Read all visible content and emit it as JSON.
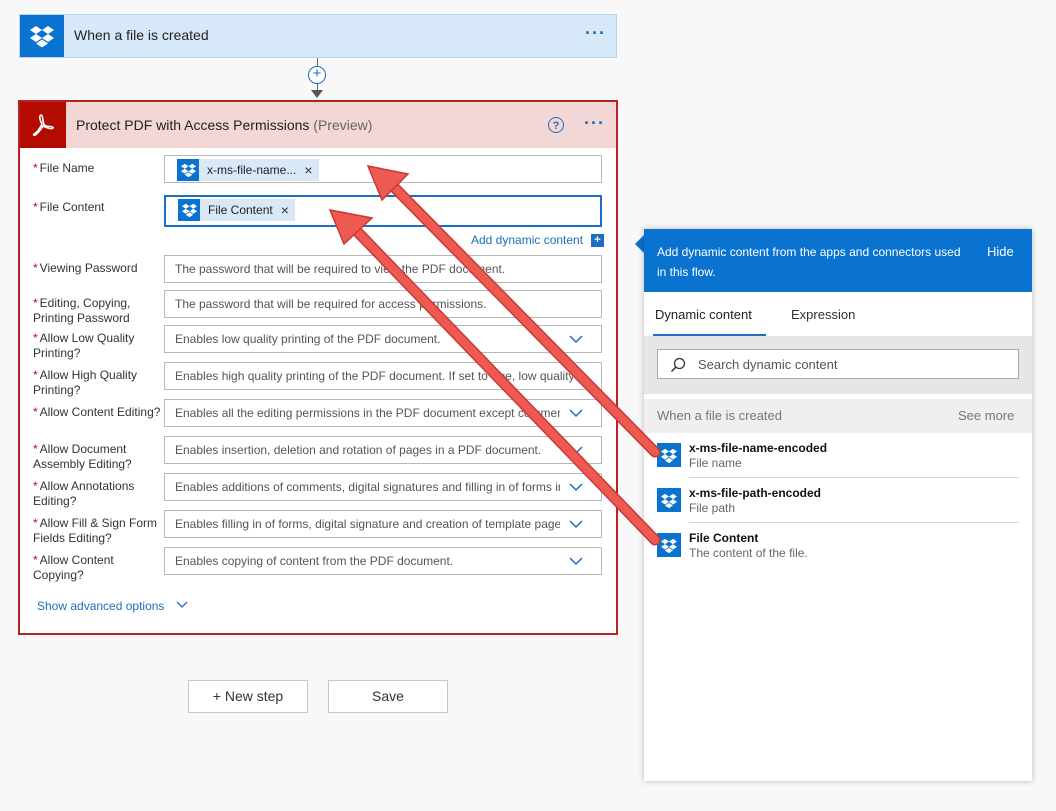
{
  "trigger": {
    "title": "When a file is created",
    "more_label": "···"
  },
  "connector": {
    "add_label": "+"
  },
  "action": {
    "title": "Protect PDF with Access Permissions",
    "preview_label": "(Preview)",
    "help_label": "?",
    "more_label": "···",
    "add_dynamic_content": "Add dynamic content",
    "add_dynamic_icon": "+",
    "show_advanced": "Show advanced options",
    "required_marker": "*",
    "fields": {
      "file_name": {
        "label": "File Name",
        "token": "x-ms-file-name...",
        "token_remove": "×"
      },
      "file_content": {
        "label": "File Content",
        "token": "File Content",
        "token_remove": "×"
      },
      "viewing_password": {
        "label": "Viewing Password",
        "placeholder": "The password that will be required to view the PDF document."
      },
      "editing_password": {
        "label": "Editing, Copying, Printing Password",
        "placeholder": "The password that will be required for access permissions."
      },
      "low_quality": {
        "label": "Allow Low Quality Printing?",
        "placeholder": "Enables low quality printing of the PDF document."
      },
      "high_quality": {
        "label": "Allow High Quality Printing?",
        "placeholder": "Enables high quality printing of the PDF document. If set to true, low quality"
      },
      "content_editing": {
        "label": "Allow Content Editing?",
        "placeholder": "Enables all the editing permissions in the PDF document except comments"
      },
      "document_assembly": {
        "label": "Allow Document Assembly Editing?",
        "placeholder": "Enables insertion, deletion and rotation of pages in a PDF document."
      },
      "annotations": {
        "label": "Allow Annotations Editing?",
        "placeholder": "Enables additions of comments, digital signatures and filling in of forms in"
      },
      "fill_sign": {
        "label": "Allow Fill & Sign Form Fields Editing?",
        "placeholder": "Enables filling in of forms, digital signature and creation of template pages"
      },
      "content_copying": {
        "label": "Allow Content Copying?",
        "placeholder": "Enables copying of content from the PDF document."
      }
    }
  },
  "buttons": {
    "new_step": "+ New step",
    "save": "Save"
  },
  "panel": {
    "info": "Add dynamic content from the apps and connectors used in this flow.",
    "hide": "Hide",
    "tabs": [
      "Dynamic content",
      "Expression"
    ],
    "search_placeholder": "Search dynamic content",
    "section_title": "When a file is created",
    "see_more": "See more",
    "items": [
      {
        "name": "x-ms-file-name-encoded",
        "desc": "File name"
      },
      {
        "name": "x-ms-file-path-encoded",
        "desc": "File path"
      },
      {
        "name": "File Content",
        "desc": "The content of the file."
      }
    ]
  },
  "colors": {
    "brand_blue": "#0a73d0",
    "action_border": "#b52424",
    "adobe_red": "#b30b00",
    "annotation_arrow": "#e9534c"
  },
  "icons": [
    "dropbox-icon",
    "adobe-acrobat-icon",
    "help-icon",
    "more-icon",
    "chevron-down-icon",
    "search-icon",
    "add-icon",
    "close-icon"
  ]
}
